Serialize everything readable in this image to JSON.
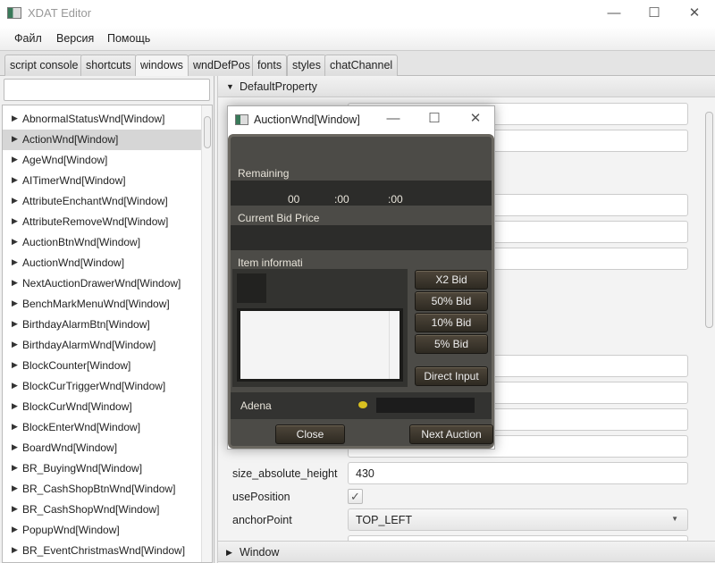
{
  "app": {
    "title": "XDAT Editor",
    "window_controls": [
      "minimize",
      "maximize",
      "close"
    ]
  },
  "menu": [
    "Файл",
    "Версия",
    "Помощь"
  ],
  "tabs": [
    {
      "label": "script console"
    },
    {
      "label": "shortcuts"
    },
    {
      "label": "windows",
      "active": true
    },
    {
      "label": "wndDefPos"
    },
    {
      "label": "fonts"
    },
    {
      "label": "styles"
    },
    {
      "label": "chatChannel"
    }
  ],
  "left": {
    "search_value": "",
    "items": [
      "AbnormalStatusWnd[Window]",
      "ActionWnd[Window]",
      "AgeWnd[Window]",
      "AITimerWnd[Window]",
      "AttributeEnchantWnd[Window]",
      "AttributeRemoveWnd[Window]",
      "AuctionBtnWnd[Window]",
      "AuctionWnd[Window]",
      "NextAuctionDrawerWnd[Window]",
      "BenchMarkMenuWnd[Window]",
      "BirthdayAlarmBtn[Window]",
      "BirthdayAlarmWnd[Window]",
      "BlockCounter[Window]",
      "BlockCurTriggerWnd[Window]",
      "BlockCurWnd[Window]",
      "BlockEnterWnd[Window]",
      "BoardWnd[Window]",
      "BR_BuyingWnd[Window]",
      "BR_CashShopBtnWnd[Window]",
      "BR_CashShopWnd[Window]",
      "PopupWnd[Window]",
      "BR_EventChristmasWnd[Window]"
    ],
    "selected": "ActionWnd[Window]"
  },
  "right": {
    "section_default": "DefaultProperty",
    "section_window": "Window",
    "size_absolute_height": {
      "label": "size_absolute_height",
      "value": "430"
    },
    "usePosition": {
      "label": "usePosition",
      "checked": true,
      "mark": "✓"
    },
    "anchorPoint": {
      "label": "anchorPoint",
      "value": "TOP_LEFT"
    }
  },
  "popup": {
    "title": "AuctionWnd[Window]",
    "remaining_label": "Remaining",
    "time": [
      "00",
      ":00",
      ":00"
    ],
    "current_bid_label": "Current Bid Price",
    "item_info_label": "Item informati",
    "buttons": {
      "x2": "X2 Bid",
      "p50": "50% Bid",
      "p10": "10% Bid",
      "p5": "5% Bid",
      "direct": "Direct Input",
      "close": "Close",
      "next": "Next Auction"
    },
    "adena_label": "Adena"
  }
}
